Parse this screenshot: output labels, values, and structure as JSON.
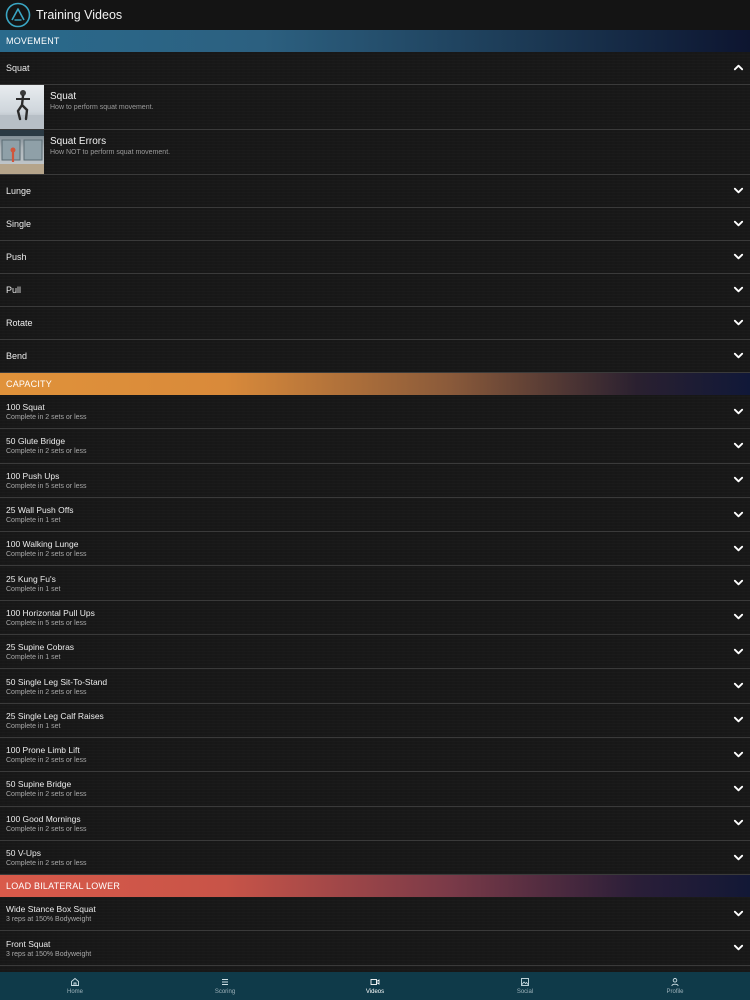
{
  "header": {
    "title": "Training Videos"
  },
  "colors": {
    "movement_start": "#2a6a8c",
    "capacity_start": "#e0923a",
    "load_start": "#d95a4a",
    "nav_bg": "#0f3a49",
    "accent": "#3aa6c4"
  },
  "movement": {
    "title": "MOVEMENT",
    "open_item": "Squat",
    "videos": [
      {
        "title": "Squat",
        "subtitle": "How to perform squat movement."
      },
      {
        "title": "Squat Errors",
        "subtitle": "How NOT to perform squat movement."
      }
    ],
    "items": [
      "Lunge",
      "Single",
      "Push",
      "Pull",
      "Rotate",
      "Bend"
    ]
  },
  "capacity": {
    "title": "CAPACITY",
    "items": [
      {
        "title": "100 Squat",
        "subtitle": "Complete in 2 sets or less"
      },
      {
        "title": "50 Glute Bridge",
        "subtitle": "Complete in 2 sets or less"
      },
      {
        "title": "100 Push Ups",
        "subtitle": "Complete in 5 sets or less"
      },
      {
        "title": "25 Wall Push Offs",
        "subtitle": "Complete in 1 set"
      },
      {
        "title": "100 Walking Lunge",
        "subtitle": "Complete in 2 sets or less"
      },
      {
        "title": "25 Kung Fu's",
        "subtitle": "Complete in 1 set"
      },
      {
        "title": "100 Horizontal Pull Ups",
        "subtitle": "Complete in 5 sets or less"
      },
      {
        "title": "25 Supine Cobras",
        "subtitle": "Complete in 1 set"
      },
      {
        "title": "50 Single Leg Sit-To-Stand",
        "subtitle": "Complete in 2 sets or less"
      },
      {
        "title": "25 Single Leg Calf Raises",
        "subtitle": "Complete in 1 set"
      },
      {
        "title": "100 Prone Limb Lift",
        "subtitle": "Complete in 2 sets or less"
      },
      {
        "title": "50 Supine Bridge",
        "subtitle": "Complete in 2 sets or less"
      },
      {
        "title": "100 Good Mornings",
        "subtitle": "Complete in 2 sets or less"
      },
      {
        "title": "50 V-Ups",
        "subtitle": "Complete in 2 sets or less"
      }
    ]
  },
  "load": {
    "title": "LOAD BILATERAL LOWER",
    "items": [
      {
        "title": "Wide Stance Box Squat",
        "subtitle": "3 reps at 150% Bodyweight"
      },
      {
        "title": "Front Squat",
        "subtitle": "3 reps at 150% Bodyweight"
      }
    ]
  },
  "nav": {
    "active": "Videos",
    "items": [
      {
        "label": "Home",
        "icon": "home-icon"
      },
      {
        "label": "Scoring",
        "icon": "list-icon"
      },
      {
        "label": "Videos",
        "icon": "video-icon"
      },
      {
        "label": "Social",
        "icon": "image-icon"
      },
      {
        "label": "Profile",
        "icon": "person-icon"
      }
    ]
  }
}
